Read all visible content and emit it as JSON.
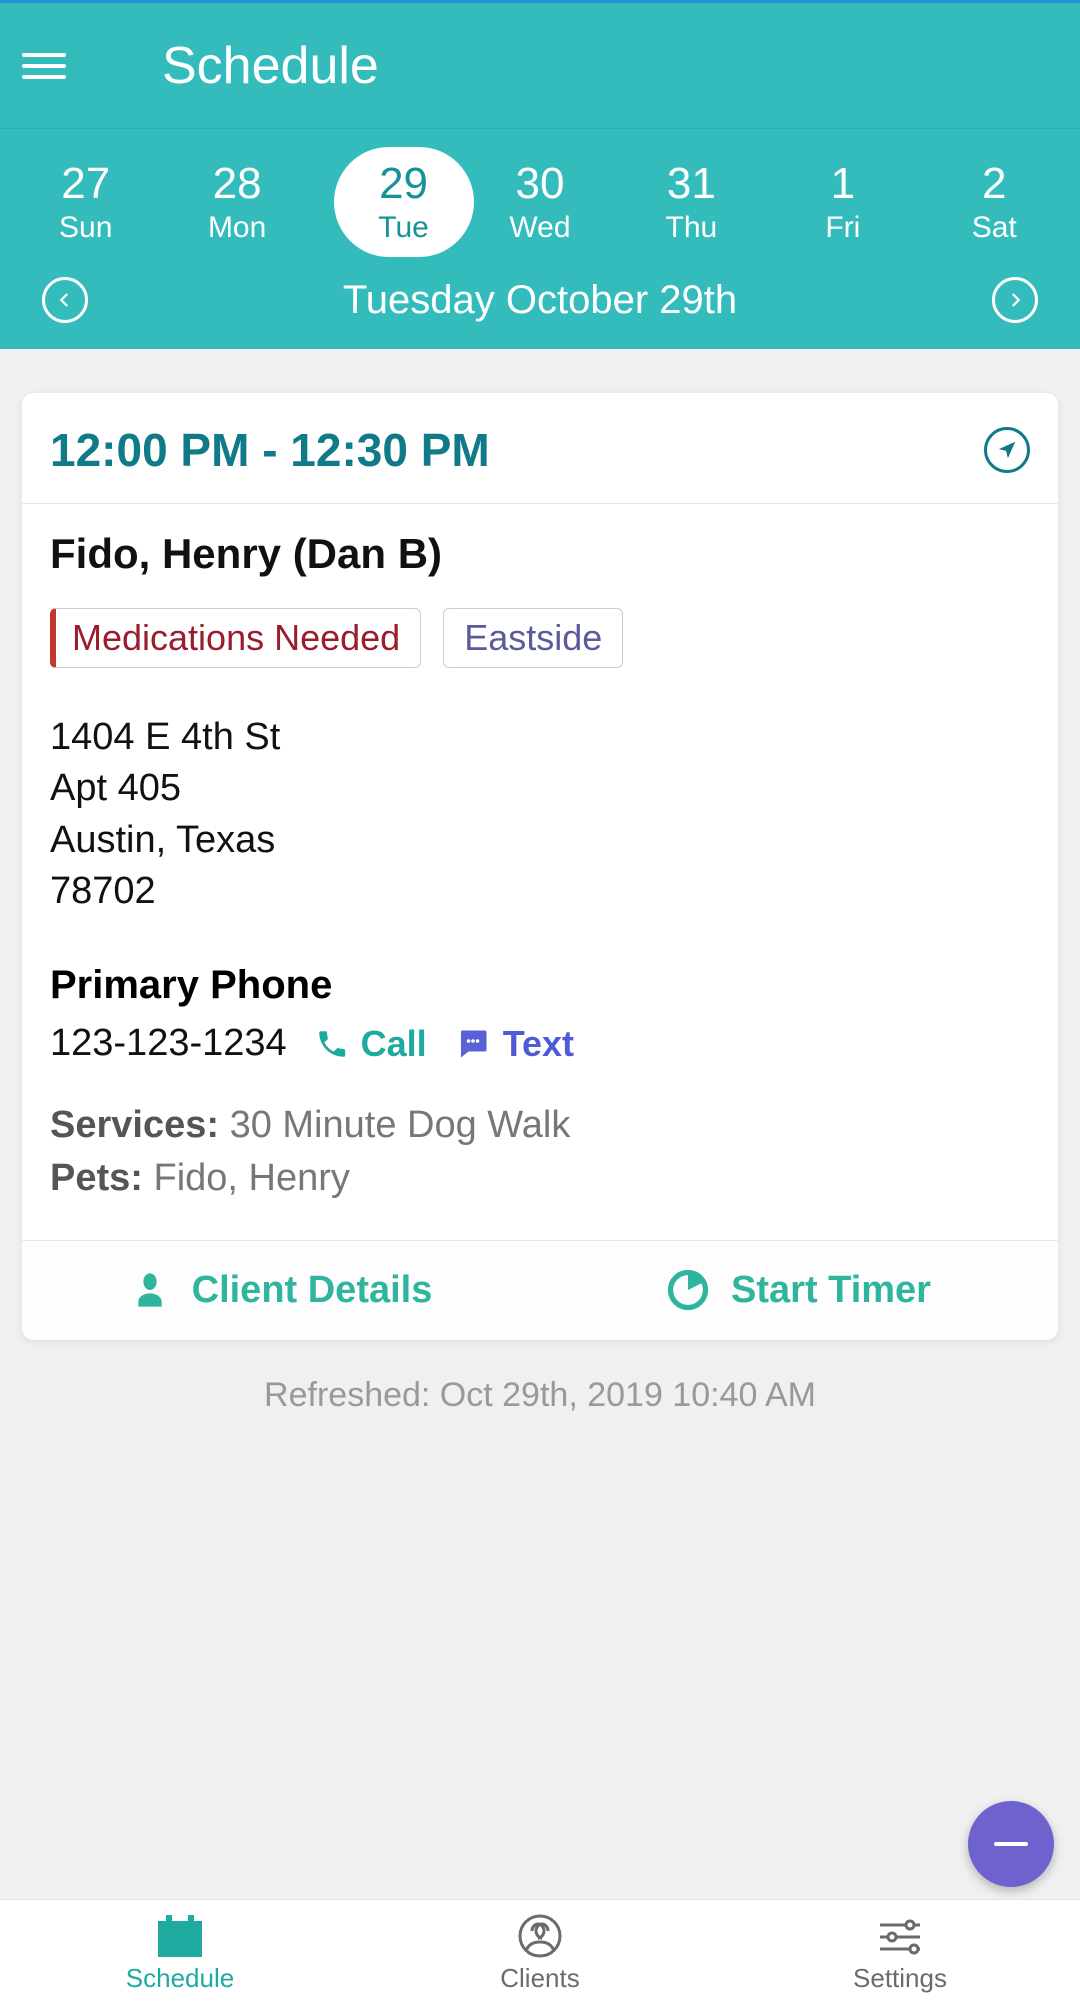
{
  "header": {
    "title": "Schedule"
  },
  "week": {
    "days": [
      {
        "num": "27",
        "dow": "Sun"
      },
      {
        "num": "28",
        "dow": "Mon"
      },
      {
        "num": "29",
        "dow": "Tue"
      },
      {
        "num": "30",
        "dow": "Wed"
      },
      {
        "num": "31",
        "dow": "Thu"
      },
      {
        "num": "1",
        "dow": "Fri"
      },
      {
        "num": "2",
        "dow": "Sat"
      }
    ],
    "selected_index": 2,
    "full_date": "Tuesday October 29th"
  },
  "appointment": {
    "time_range": "12:00 PM - 12:30 PM",
    "client_name": "Fido, Henry (Dan B)",
    "tags": {
      "medications": "Medications Needed",
      "area": "Eastside"
    },
    "address": {
      "line1": "1404 E 4th St",
      "line2": "Apt 405",
      "city_state": "Austin, Texas",
      "zip": "78702"
    },
    "phone": {
      "label": "Primary Phone",
      "number": "123-123-1234",
      "call_label": "Call",
      "text_label": "Text"
    },
    "services_label": "Services:",
    "services_value": "30 Minute Dog Walk",
    "pets_label": "Pets:",
    "pets_value": "Fido, Henry",
    "client_details_label": "Client Details",
    "start_timer_label": "Start Timer"
  },
  "refreshed": "Refreshed: Oct 29th, 2019 10:40 AM",
  "bottom_nav": {
    "schedule": "Schedule",
    "clients": "Clients",
    "settings": "Settings"
  }
}
